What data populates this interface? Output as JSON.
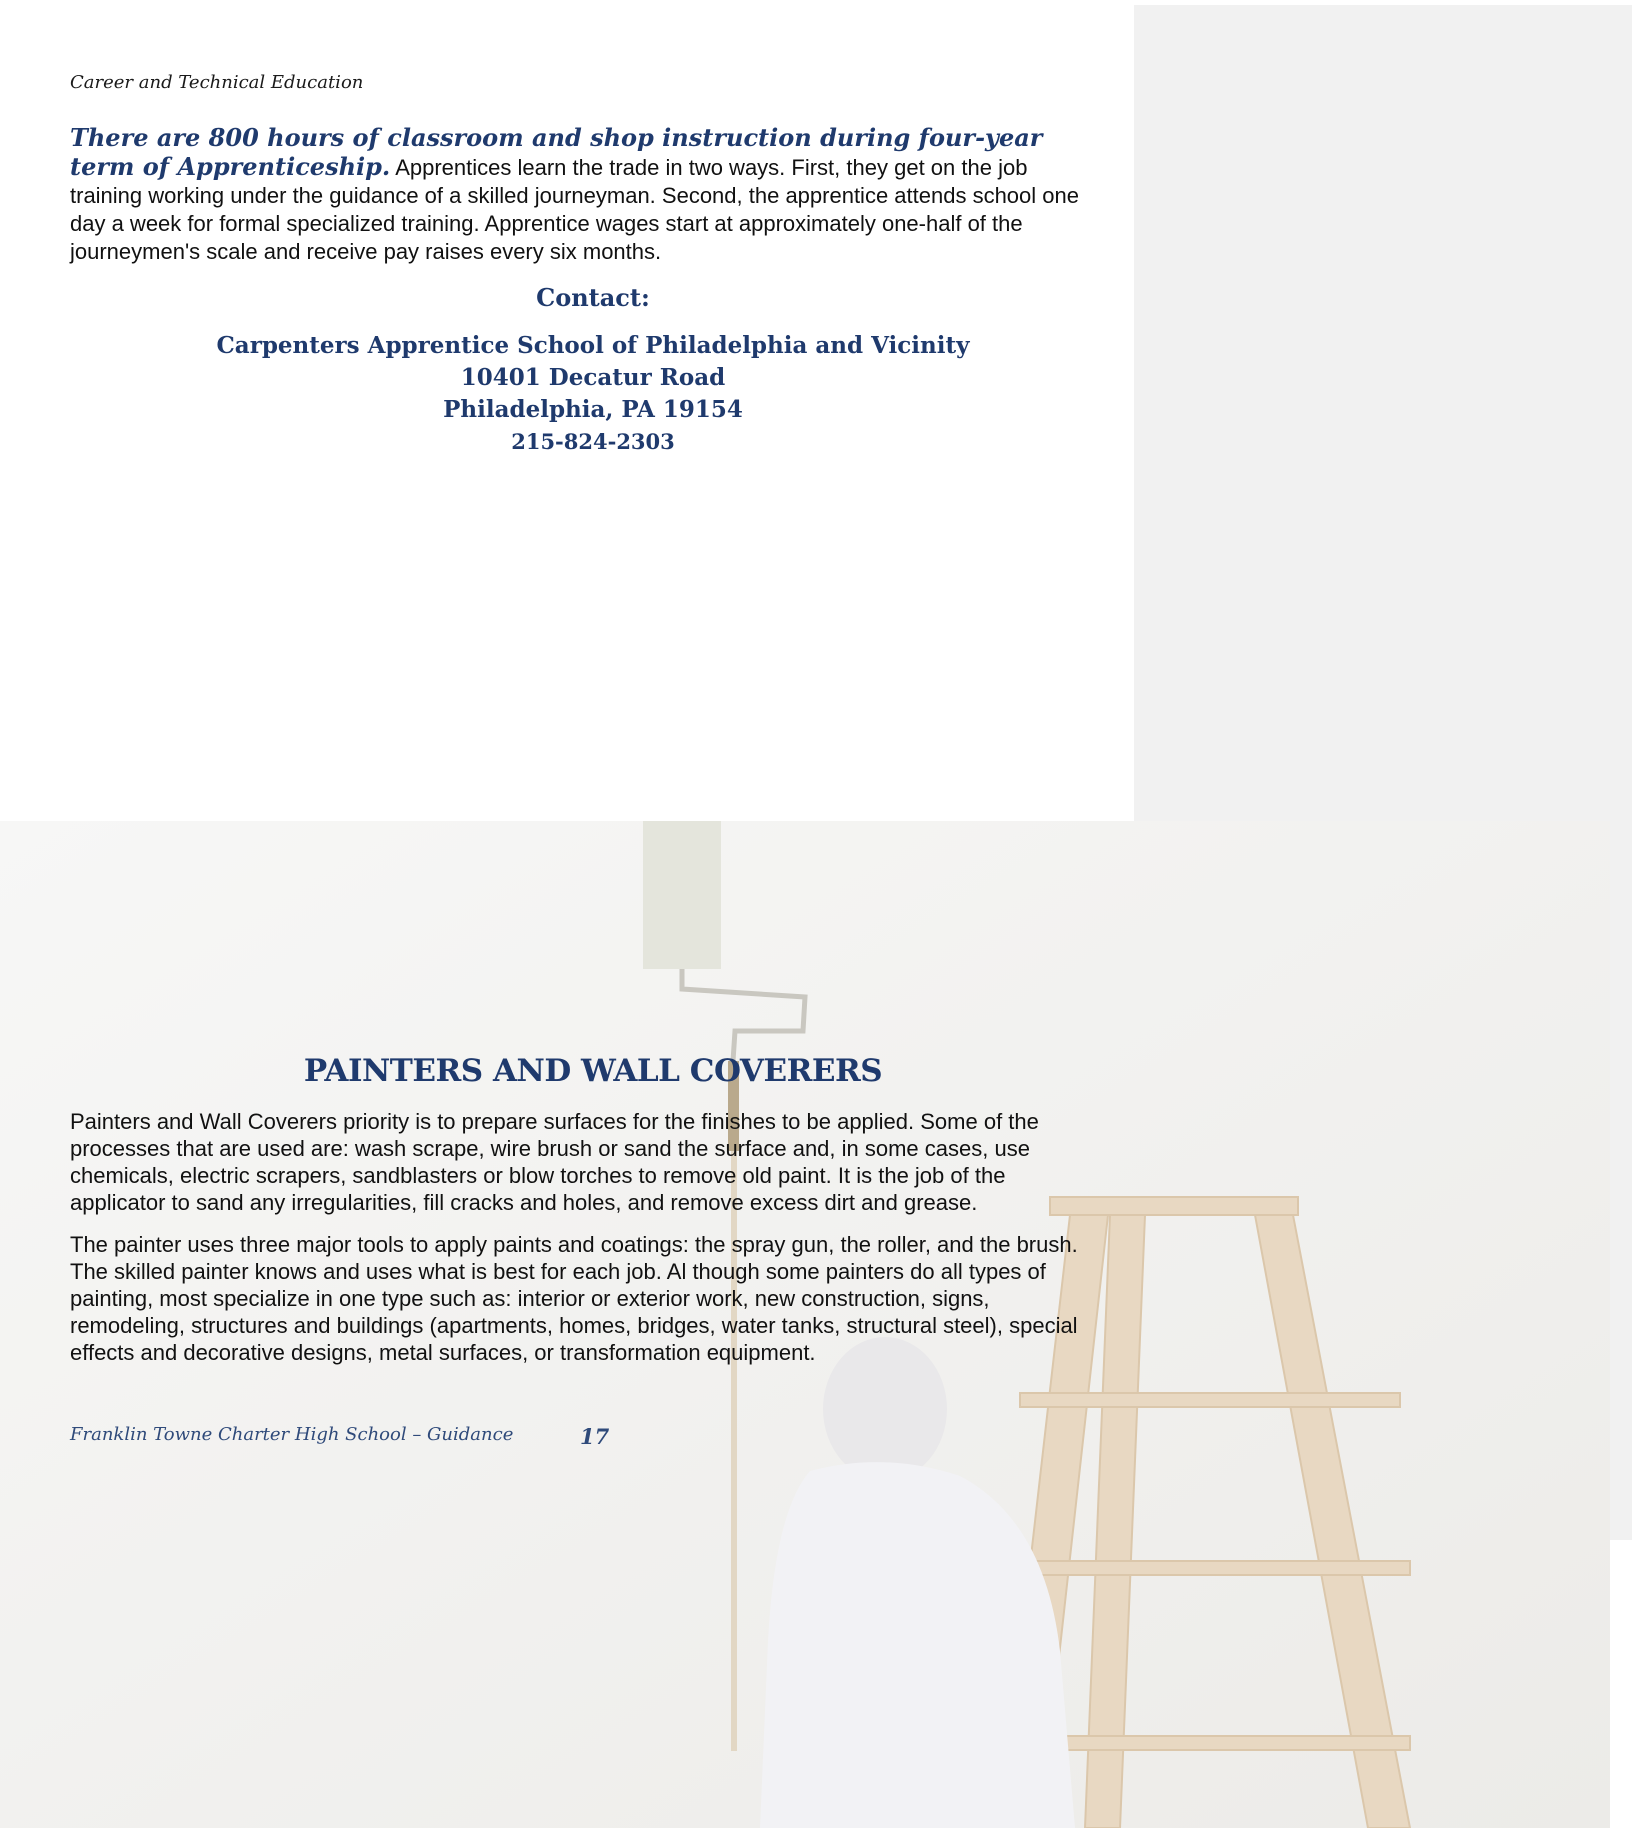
{
  "header": {
    "running_title": "Career and Technical Education"
  },
  "apprenticeship": {
    "lead_highlight": "There are 800 hours of classroom and shop instruction during four-year term of Apprenticeship.",
    "lead_body": "Apprentices learn the trade in two ways. First, they get on the job training working under the guidance of a skilled journeyman. Second, the apprentice attends school one day a week for formal specialized training. Apprentice wages start at approximately one-half of the journeymen's scale and receive pay raises every six months."
  },
  "contact": {
    "heading": "Contact:",
    "name": "Carpenters Apprentice School of Philadelphia and Vicinity",
    "street": "10401 Decatur Road",
    "city": "Philadelphia, PA 19154",
    "phone": "215-824-2303"
  },
  "painters": {
    "title": "PAINTERS AND WALL COVERERS",
    "paragraph_1": "Painters and Wall Coverers priority is to prepare surfaces for the finishes to be applied. Some of the processes that are used are: wash scrape, wire brush or sand the surface and, in some cases, use chemicals, electric scrapers, sandblasters or blow torches to remove old paint. It is the job of the applicator to sand any irregularities, fill cracks and holes, and remove excess dirt and grease.",
    "paragraph_2": "The painter uses three major tools to apply paints and coatings: the spray gun, the roller, and the brush. The skilled painter knows and uses what is best for each job. Al though some painters do all types of painting, most specialize in one type such as: interior or exterior work, new construction, signs, remodeling, structures and buildings (apartments, homes, bridges, water tanks, structural steel), special effects and decorative designs, metal surfaces, or transformation equipment."
  },
  "footer": {
    "school": "Franklin Towne Charter High School – Guidance",
    "page_number": "17"
  },
  "colors": {
    "accent_navy": "#1f3a6d",
    "panel_gray": "#f1f1f1"
  }
}
